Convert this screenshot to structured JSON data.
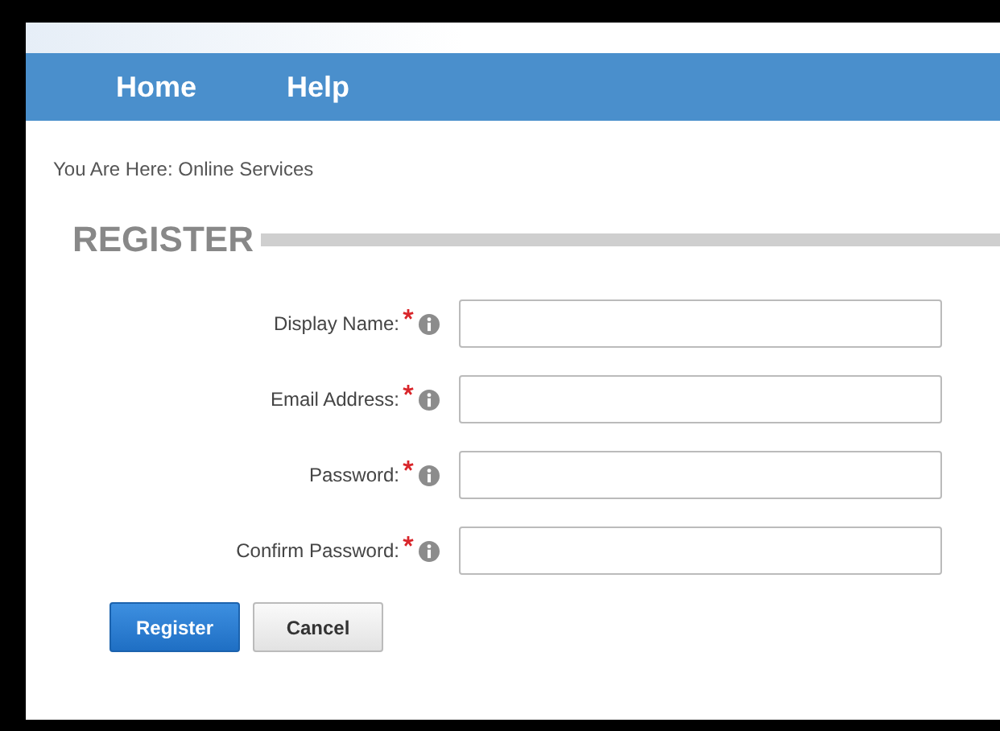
{
  "nav": [
    {
      "label": "Home"
    },
    {
      "label": "Help"
    }
  ],
  "breadcrumb": "You Are Here: Online Services",
  "heading": "REGISTER",
  "fields": [
    {
      "label": "Display Name:",
      "required": true
    },
    {
      "label": "Email Address:",
      "required": true
    },
    {
      "label": "Password:",
      "required": true
    },
    {
      "label": "Confirm Password:",
      "required": true
    }
  ],
  "buttons": [
    {
      "label": "Register",
      "kind": "primary"
    },
    {
      "label": "Cancel",
      "kind": "secondary"
    }
  ]
}
